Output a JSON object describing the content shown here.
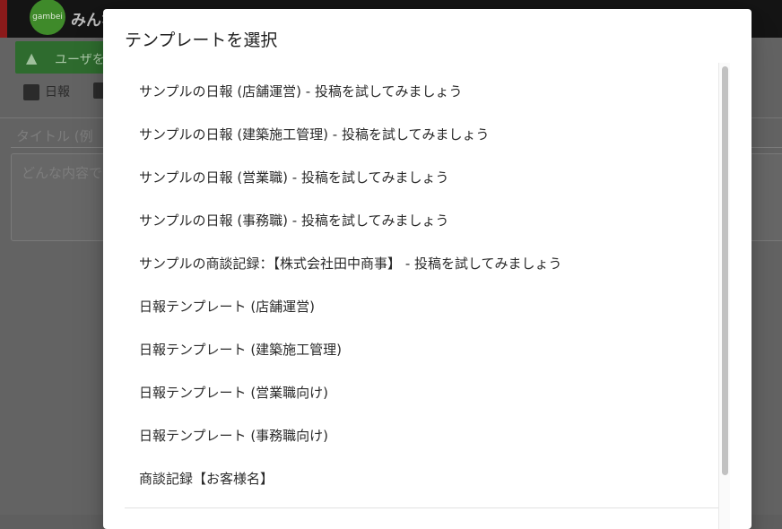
{
  "background": {
    "logo_text": "gambei",
    "app_title": "みんな",
    "add_user_label": "ユーザを",
    "tabs": [
      {
        "label": "日報",
        "icon": "calendar-icon"
      },
      {
        "label": "",
        "icon": "chart-icon"
      }
    ],
    "title_placeholder": "タイトル (例",
    "body_placeholder": "どんな内容で"
  },
  "dialog": {
    "title": "テンプレートを選択",
    "items": [
      "サンプルの日報 (店舗運営) - 投稿を試してみましょう",
      "サンプルの日報 (建築施工管理) - 投稿を試してみましょう",
      "サンプルの日報 (営業職) - 投稿を試してみましょう",
      "サンプルの日報 (事務職) - 投稿を試してみましょう",
      "サンプルの商談記録：【株式会社田中商事】 - 投稿を試してみましょう",
      "日報テンプレート (店舗運営)",
      "日報テンプレート (建築施工管理)",
      "日報テンプレート (営業職向け)",
      "日報テンプレート (事務職向け)",
      "商談記録【お客様名】"
    ]
  }
}
